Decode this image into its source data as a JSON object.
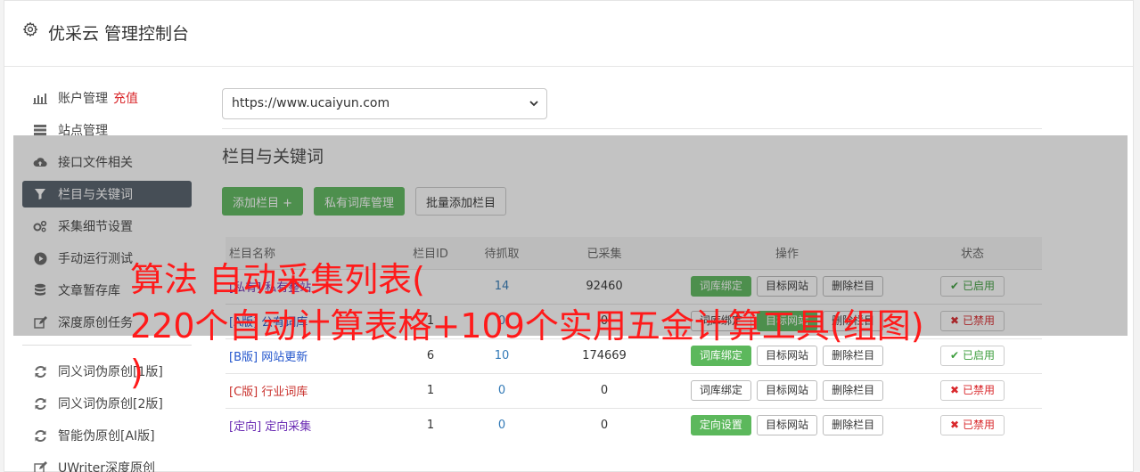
{
  "header": {
    "title": "优采云 管理控制台"
  },
  "sidebar": {
    "items": [
      {
        "label": "账户管理",
        "extra": "充值",
        "icon": "bar-chart-icon"
      },
      {
        "label": "站点管理",
        "icon": "server-icon"
      },
      {
        "label": "接口文件相关",
        "icon": "cloud-upload-icon"
      },
      {
        "label": "栏目与关键词",
        "icon": "filter-icon",
        "active": true
      },
      {
        "label": "采集细节设置",
        "icon": "gears-icon"
      },
      {
        "label": "手动运行测试",
        "icon": "play-circle-icon"
      },
      {
        "label": "文章暂存库",
        "icon": "database-icon"
      },
      {
        "label": "深度原创任务",
        "icon": "edit-icon"
      }
    ],
    "items2": [
      {
        "label": "同义词伪原创[1版]",
        "icon": "refresh-icon"
      },
      {
        "label": "同义词伪原创[2版]",
        "icon": "refresh-icon"
      },
      {
        "label": "智能伪原创[AI版]",
        "icon": "refresh-icon"
      },
      {
        "label": "UWriter深度原创",
        "icon": "edit-icon"
      }
    ]
  },
  "site_select": {
    "value": "https://www.ucaiyun.com"
  },
  "section": {
    "title": "栏目与关键词"
  },
  "buttons": {
    "add_column": "添加栏目 +",
    "private_lib": "私有词库管理",
    "batch_add": "批量添加栏目"
  },
  "table": {
    "headers": [
      "栏目名称",
      "栏目ID",
      "待抓取",
      "已采集",
      "操作",
      "状态"
    ],
    "rows": [
      {
        "tag": "[私有]",
        "name": "私有整站",
        "id": "",
        "pending": "14",
        "collected": "92460",
        "op1": "词库绑定",
        "op1_green": true,
        "op2": "目标网站",
        "op3": "删除栏目",
        "status": "已启用",
        "on": true,
        "tag_color": "purple"
      },
      {
        "tag": "[A版]",
        "name": "公有词库",
        "id": "1",
        "pending": "0",
        "collected": "0",
        "op1": "词库绑定",
        "op1_green": false,
        "op2": "目标网站",
        "op3": "删除栏目",
        "status": "已禁用",
        "on": false,
        "tag_color": "blue"
      },
      {
        "tag": "[B版]",
        "name": "网站更新",
        "id": "6",
        "pending": "10",
        "collected": "174669",
        "op1": "词库绑定",
        "op1_green": true,
        "op2": "目标网站",
        "op3": "删除栏目",
        "status": "已启用",
        "on": true,
        "tag_color": "blue"
      },
      {
        "tag": "[C版]",
        "name": "行业词库",
        "id": "1",
        "pending": "0",
        "collected": "0",
        "op1": "词库绑定",
        "op1_green": false,
        "op2": "目标网站",
        "op3": "删除栏目",
        "status": "已禁用",
        "on": false,
        "tag_color": "red"
      },
      {
        "tag": "[定向]",
        "name": "定向采集",
        "id": "1",
        "pending": "0",
        "collected": "0",
        "op1": "定向设置",
        "op1_green": true,
        "op2": "目标网站",
        "op3": "删除栏目",
        "status": "已禁用",
        "on": false,
        "tag_color": "purple"
      }
    ]
  },
  "watermark": {
    "line1": "算法 自动采集列表(",
    "line2": "220个自动计算表格+109个实用五金计算工具(组图)",
    "line3": ")"
  }
}
